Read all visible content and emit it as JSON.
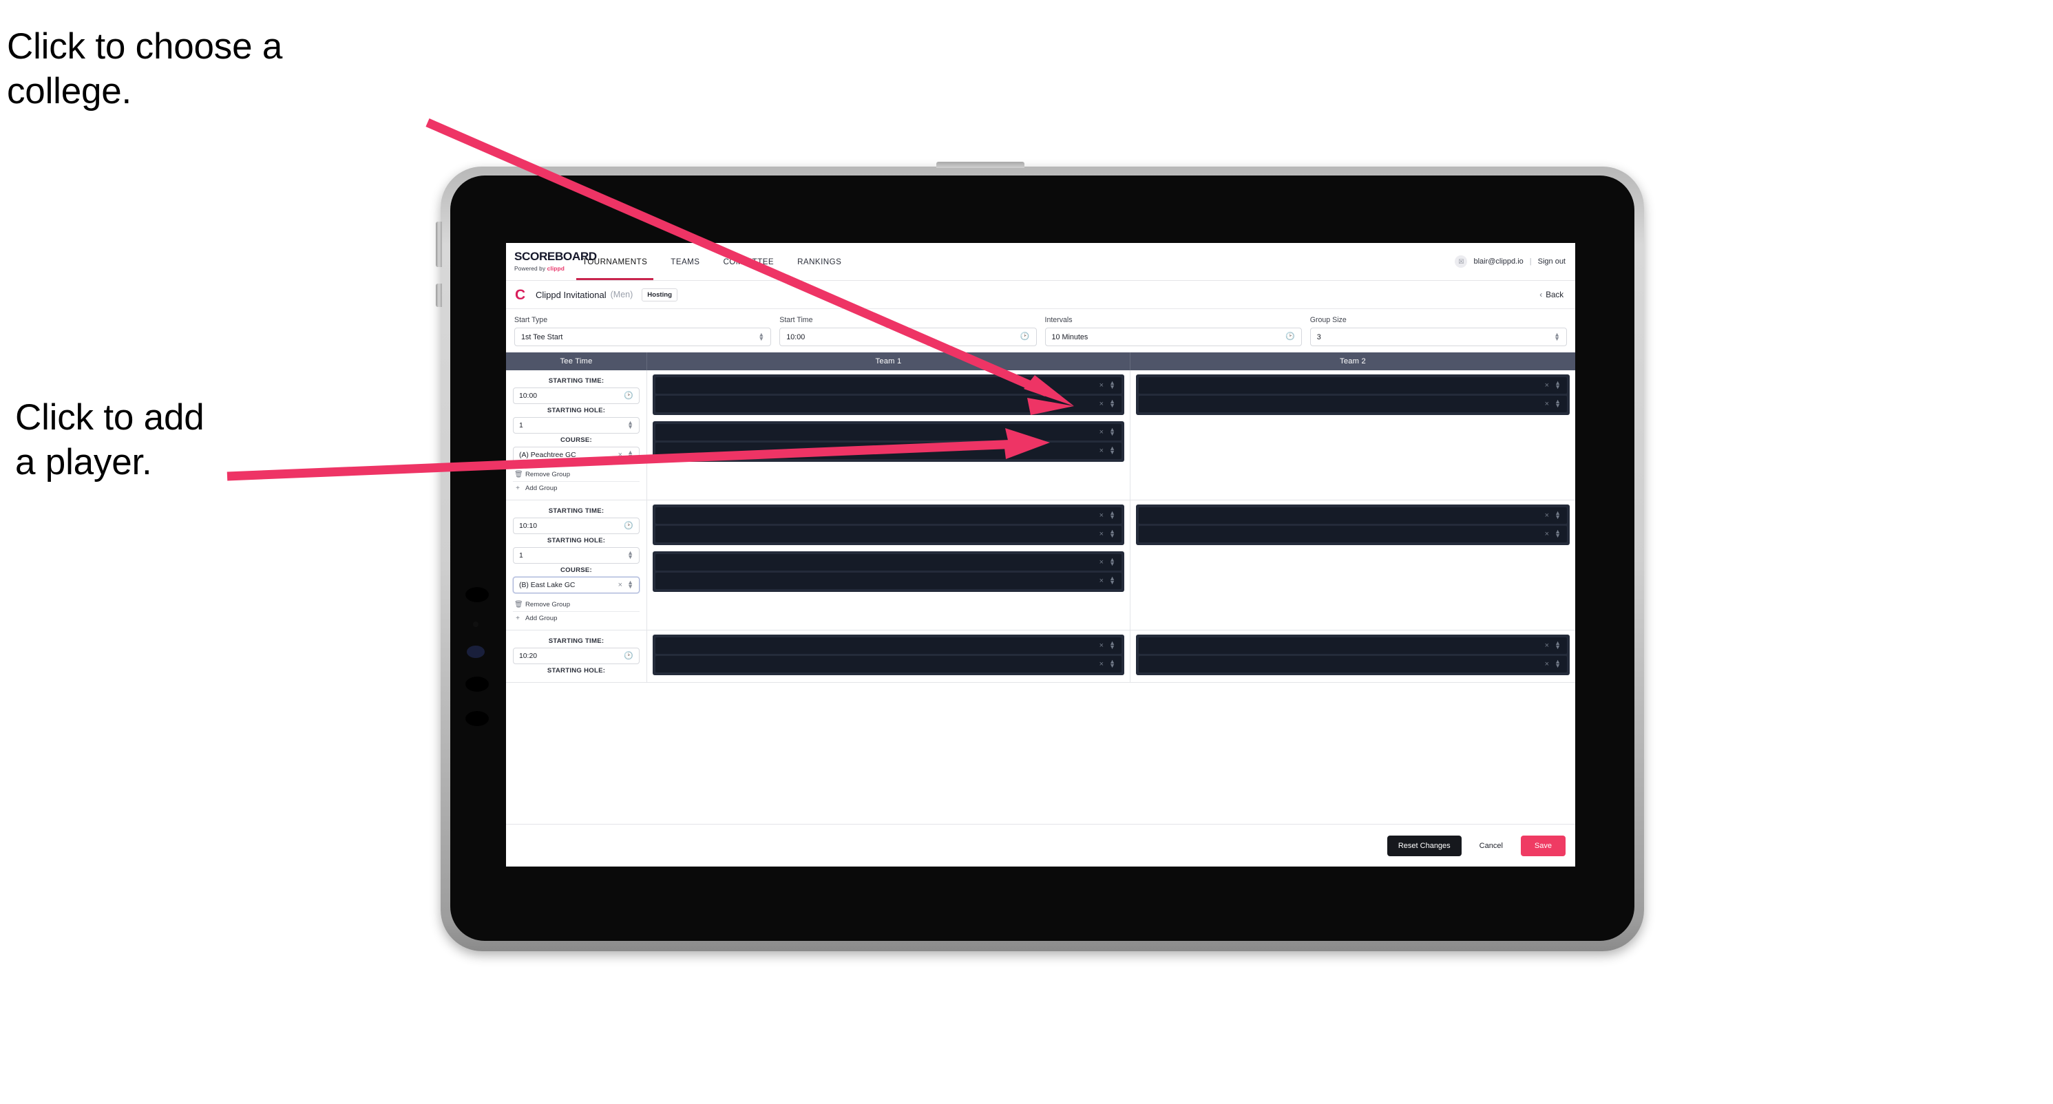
{
  "annotations": {
    "college": "Click to choose a\ncollege.",
    "player": "Click to add\na player."
  },
  "colors": {
    "accent_pink": "#ef3b63",
    "annotation_arrow": "#ee3465",
    "nav_underline": "#c9254e",
    "table_header": "#4f5569",
    "slot_card": "#242b3a",
    "slot_inner": "#151b27",
    "reset_button": "#16181d"
  },
  "topnav": {
    "brand_word": "SCOREBOARD",
    "brand_sub_prefix": "Powered by ",
    "brand_sub_name": "clippd",
    "links": [
      {
        "label": "TOURNAMENTS",
        "active": true
      },
      {
        "label": "TEAMS",
        "active": false
      },
      {
        "label": "COMMITTEE",
        "active": false
      },
      {
        "label": "RANKINGS",
        "active": false
      }
    ],
    "avatar_glyph": "☒",
    "user_email": "blair@clippd.io",
    "separator": "|",
    "sign_out": "Sign out"
  },
  "tournament": {
    "logo_letter": "C",
    "name": "Clippd Invitational",
    "gender": "(Men)",
    "badge": "Hosting",
    "back_chevron": "‹",
    "back_label": "Back"
  },
  "controls": [
    {
      "label": "Start Type",
      "value": "1st Tee Start",
      "icon": "stepper-icon"
    },
    {
      "label": "Start Time",
      "value": "10:00",
      "icon": "clock-icon"
    },
    {
      "label": "Intervals",
      "value": "10 Minutes",
      "icon": "clock-icon"
    },
    {
      "label": "Group Size",
      "value": "3",
      "icon": "stepper-icon"
    }
  ],
  "table": {
    "headers": {
      "tee_time": "Tee Time",
      "team1": "Team 1",
      "team2": "Team 2"
    },
    "field_labels": {
      "starting_time": "STARTING TIME:",
      "starting_hole": "STARTING HOLE:",
      "course": "COURSE:"
    },
    "actions": {
      "remove_group": "Remove Group",
      "add_group": "Add Group"
    },
    "icons": {
      "clock": "clock-icon",
      "stepper": "stepper-icon",
      "clear": "×",
      "trash": "trash-icon",
      "plus": "+"
    },
    "groups": [
      {
        "starting_time": "10:00",
        "starting_hole": "1",
        "course": "(A) Peachtree GC",
        "course_focused": false,
        "team1_cards": [
          {
            "slots": 2
          },
          {
            "slots": 2
          }
        ],
        "team2_cards": [
          {
            "slots": 2
          }
        ]
      },
      {
        "starting_time": "10:10",
        "starting_hole": "1",
        "course": "(B) East Lake GC",
        "course_focused": true,
        "team1_cards": [
          {
            "slots": 2
          },
          {
            "slots": 2
          }
        ],
        "team2_cards": [
          {
            "slots": 2
          }
        ]
      },
      {
        "starting_time": "10:20",
        "starting_hole": "",
        "course": "",
        "course_focused": false,
        "partial": true,
        "team1_cards": [
          {
            "slots": 2
          }
        ],
        "team2_cards": [
          {
            "slots": 2
          }
        ]
      }
    ]
  },
  "footer": {
    "reset": "Reset Changes",
    "cancel": "Cancel",
    "save": "Save"
  }
}
